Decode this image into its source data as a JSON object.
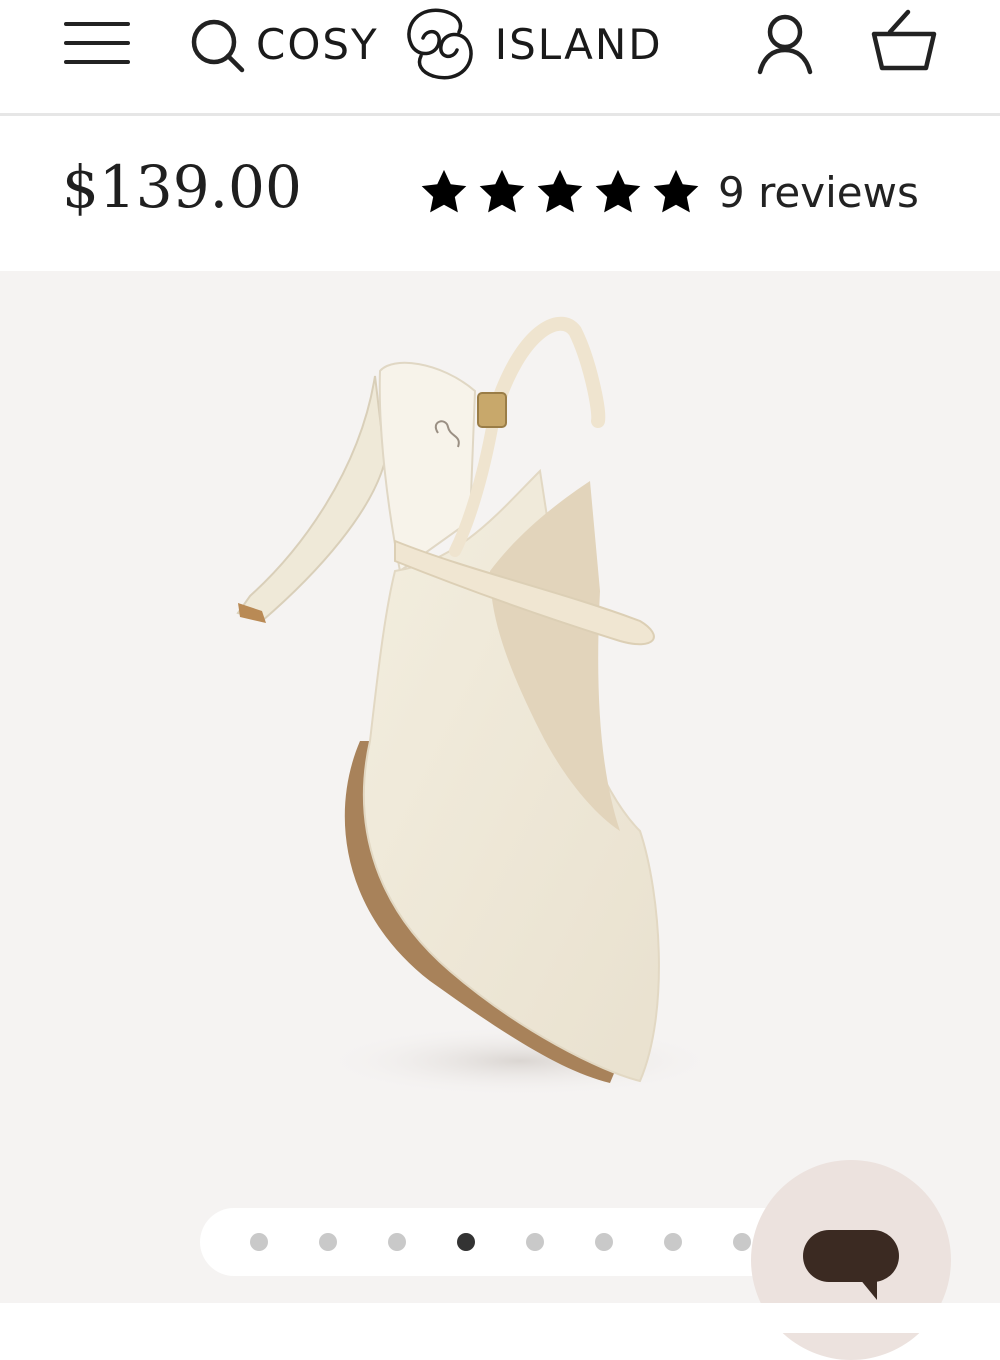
{
  "header": {
    "brand_left": "COSY",
    "brand_right": "ISLAND",
    "icons": [
      "menu-icon",
      "search-icon",
      "brand-logo",
      "account-icon",
      "cart-icon"
    ]
  },
  "product": {
    "price": "$139.00",
    "rating": {
      "stars": 5,
      "max_stars": 5,
      "reviews_label": "9 reviews"
    }
  },
  "gallery": {
    "dot_count": 8,
    "active_index": 3
  },
  "chat": {
    "icon": "chat-bubble-icon"
  },
  "colors": {
    "accent_text": "#1f1f1f",
    "gallery_bg": "#f5f3f2",
    "chat_button_bg": "#ece2de",
    "chat_icon": "#3b2a22",
    "dot_inactive": "#c9c9c9",
    "dot_active": "#333333"
  }
}
